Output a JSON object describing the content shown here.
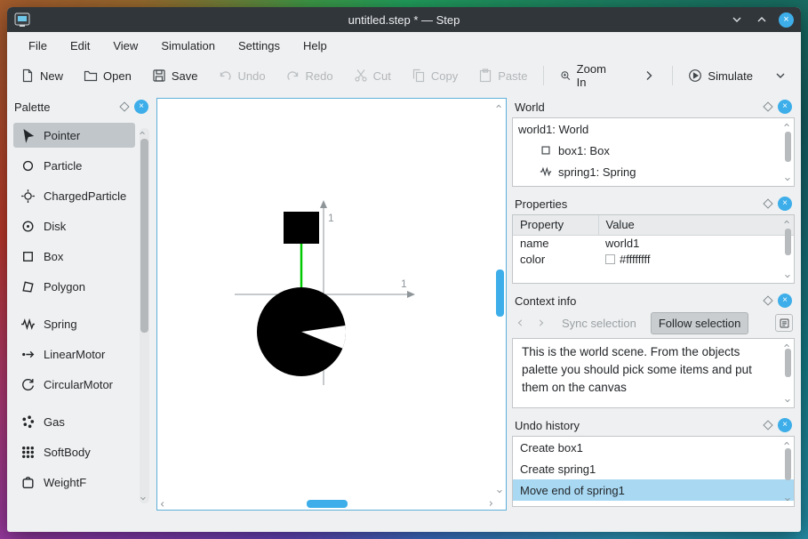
{
  "window": {
    "title": "untitled.step * — Step"
  },
  "menu": {
    "items": [
      "File",
      "Edit",
      "View",
      "Simulation",
      "Settings",
      "Help"
    ]
  },
  "toolbar": {
    "new": "New",
    "open": "Open",
    "save": "Save",
    "undo": "Undo",
    "redo": "Redo",
    "cut": "Cut",
    "copy": "Copy",
    "paste": "Paste",
    "zoom_in": "Zoom In",
    "simulate": "Simulate"
  },
  "palette": {
    "title": "Palette",
    "items": [
      {
        "label": "Pointer",
        "selected": true
      },
      {
        "label": "Particle"
      },
      {
        "label": "ChargedParticle"
      },
      {
        "label": "Disk"
      },
      {
        "label": "Box"
      },
      {
        "label": "Polygon"
      },
      {
        "label": "Spring"
      },
      {
        "label": "LinearMotor"
      },
      {
        "label": "CircularMotor"
      },
      {
        "label": "Gas"
      },
      {
        "label": "SoftBody"
      },
      {
        "label": "WeightF"
      }
    ]
  },
  "canvas": {
    "x_tick": "1",
    "y_tick": "1"
  },
  "world": {
    "title": "World",
    "root": "world1: World",
    "children": [
      {
        "label": "box1: Box"
      },
      {
        "label": "spring1: Spring"
      }
    ]
  },
  "properties": {
    "title": "Properties",
    "columns": {
      "property": "Property",
      "value": "Value"
    },
    "rows": [
      {
        "property": "name",
        "value": "world1"
      },
      {
        "property": "color",
        "value": "#ffffffff"
      }
    ]
  },
  "context": {
    "title": "Context info",
    "sync_label": "Sync selection",
    "follow_label": "Follow selection",
    "body": "This is the world scene. From the objects palette you should pick some items and put them on the canvas"
  },
  "undo": {
    "title": "Undo history",
    "items": [
      {
        "label": "Create box1"
      },
      {
        "label": "Create spring1"
      },
      {
        "label": "Move end of spring1",
        "selected": true
      }
    ]
  },
  "icons": {
    "close_glyph": "×",
    "float_glyph": "◇",
    "chevron": "›"
  },
  "colors": {
    "accent": "#3daee9",
    "selection": "#a8d8f2",
    "spring": "#00c800",
    "titlebar": "#31363b",
    "window_bg": "#eff0f1"
  }
}
